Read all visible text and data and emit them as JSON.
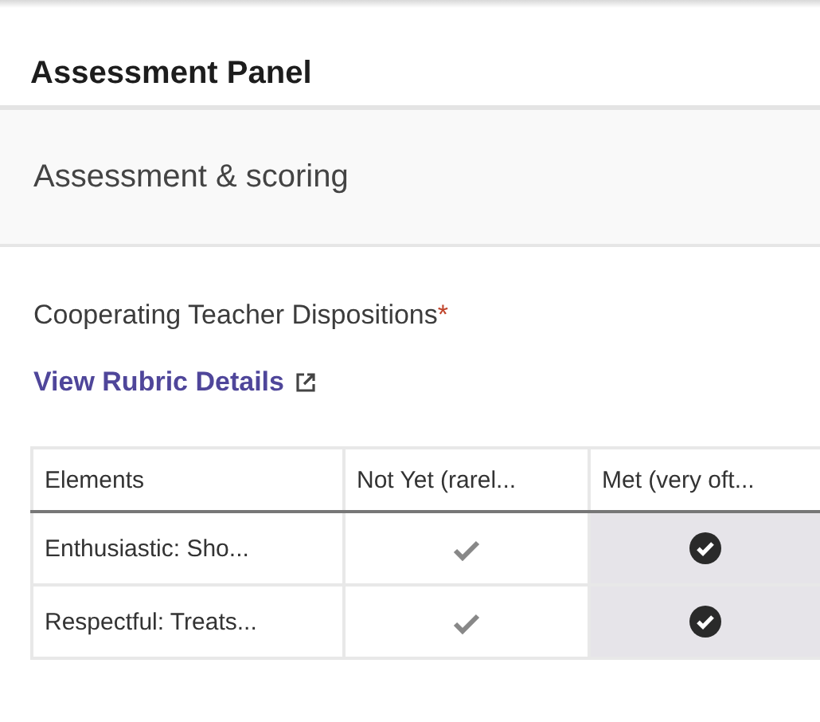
{
  "panel": {
    "title": "Assessment Panel"
  },
  "section": {
    "title": "Assessment & scoring"
  },
  "rubric": {
    "label": "Cooperating Teacher Dispositions",
    "required_mark": "*",
    "link": "View Rubric Details"
  },
  "table": {
    "columns": [
      "Elements",
      "Not Yet (rarel...",
      "Met (very oft..."
    ],
    "rows": [
      {
        "element": "Enthusiastic: Sho...",
        "ratings": [
          {
            "selected": false
          },
          {
            "selected": true
          }
        ]
      },
      {
        "element": "Respectful: Treats...",
        "ratings": [
          {
            "selected": false
          },
          {
            "selected": true
          }
        ]
      }
    ]
  }
}
